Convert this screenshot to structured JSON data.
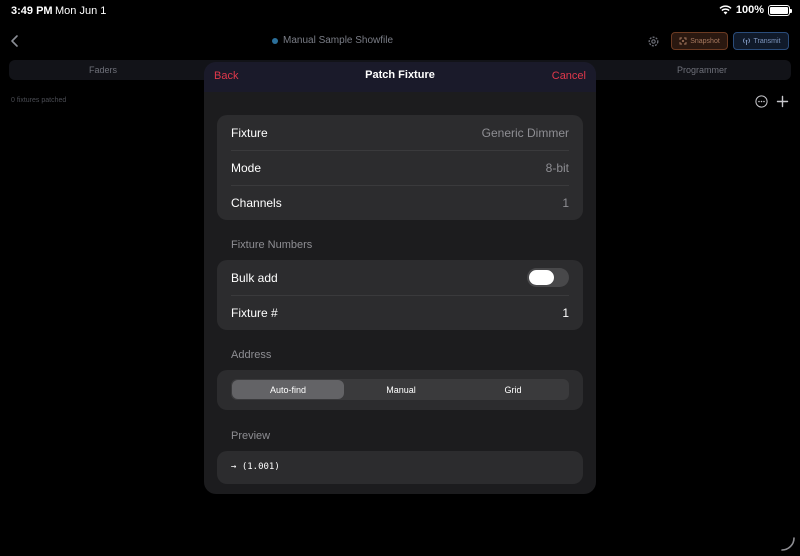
{
  "status": {
    "time": "3:49 PM",
    "date": "Mon Jun 1",
    "battery": "100%",
    "battery_level": 1.0
  },
  "nav": {
    "title": "Manual Sample Showfile",
    "snapshot_label": "Snapshot",
    "transmit_label": "Transmit"
  },
  "tabs": {
    "left": "Faders",
    "right": "Programmer"
  },
  "list": {
    "patched_count": "0 fixtures patched"
  },
  "modal": {
    "back_label": "Back",
    "title": "Patch Fixture",
    "cancel_label": "Cancel",
    "fixture_rows": [
      {
        "label": "Fixture",
        "value": "Generic Dimmer"
      },
      {
        "label": "Mode",
        "value": "8-bit"
      },
      {
        "label": "Channels",
        "value": "1"
      }
    ],
    "numbers_section": "Fixture Numbers",
    "bulk_add_label": "Bulk add",
    "bulk_add_on": false,
    "fixture_number_label": "Fixture #",
    "fixture_number_value": "1",
    "address_section": "Address",
    "address_options": [
      "Auto-find",
      "Manual",
      "Grid"
    ],
    "address_selected": "Auto-find",
    "preview_section": "Preview",
    "preview_text": "→ (1.001)"
  },
  "colors": {
    "accent": "#e0384b",
    "modal_bg": "#1c1c1e",
    "group_bg": "#2c2c2e"
  }
}
